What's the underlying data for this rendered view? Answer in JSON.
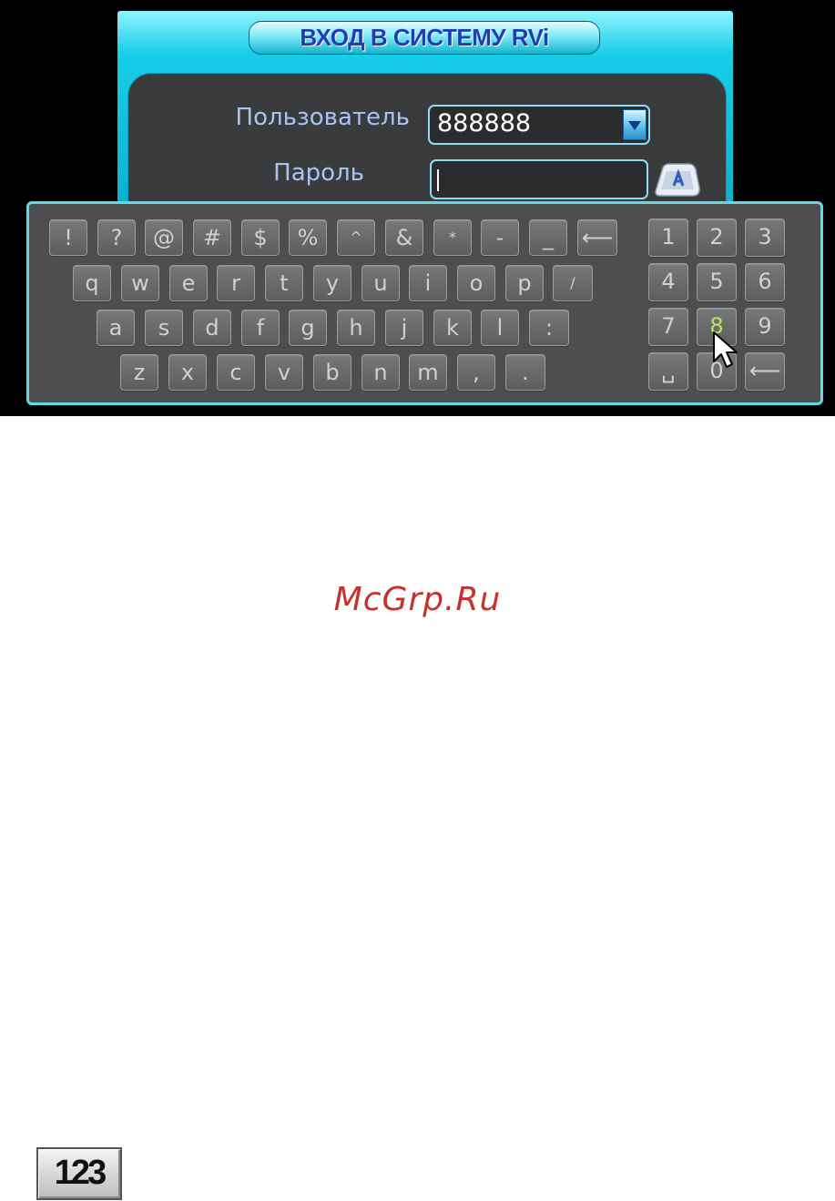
{
  "login": {
    "title": "ВХОД В СИСТЕМУ RVi",
    "user_label": "Пользователь",
    "user_value": "888888",
    "password_label": "Пароль",
    "password_value": ""
  },
  "keyboard": {
    "row1": [
      "!",
      "?",
      "@",
      "#",
      "$",
      "%",
      "^",
      "&",
      "*",
      "-",
      "_",
      "⟵"
    ],
    "row2": [
      "q",
      "w",
      "e",
      "r",
      "t",
      "y",
      "u",
      "i",
      "o",
      "p",
      "/"
    ],
    "row3": [
      "a",
      "s",
      "d",
      "f",
      "g",
      "h",
      "j",
      "k",
      "l",
      ":"
    ],
    "row4": [
      "z",
      "x",
      "c",
      "v",
      "b",
      "n",
      "m",
      ",",
      "."
    ],
    "numpad": [
      "1",
      "2",
      "3",
      "4",
      "5",
      "6",
      "7",
      "8",
      "9",
      "␣",
      "0",
      "⟵"
    ],
    "highlighted_key": "8"
  },
  "watermark": "McGrp.Ru",
  "icon_label": "123",
  "colors": {
    "frame_cyan": "#19cde8",
    "title_text": "#1f3fb0",
    "label_text": "#a7c4f2",
    "highlight_key": "#b6e85b",
    "watermark": "#c9302c"
  }
}
